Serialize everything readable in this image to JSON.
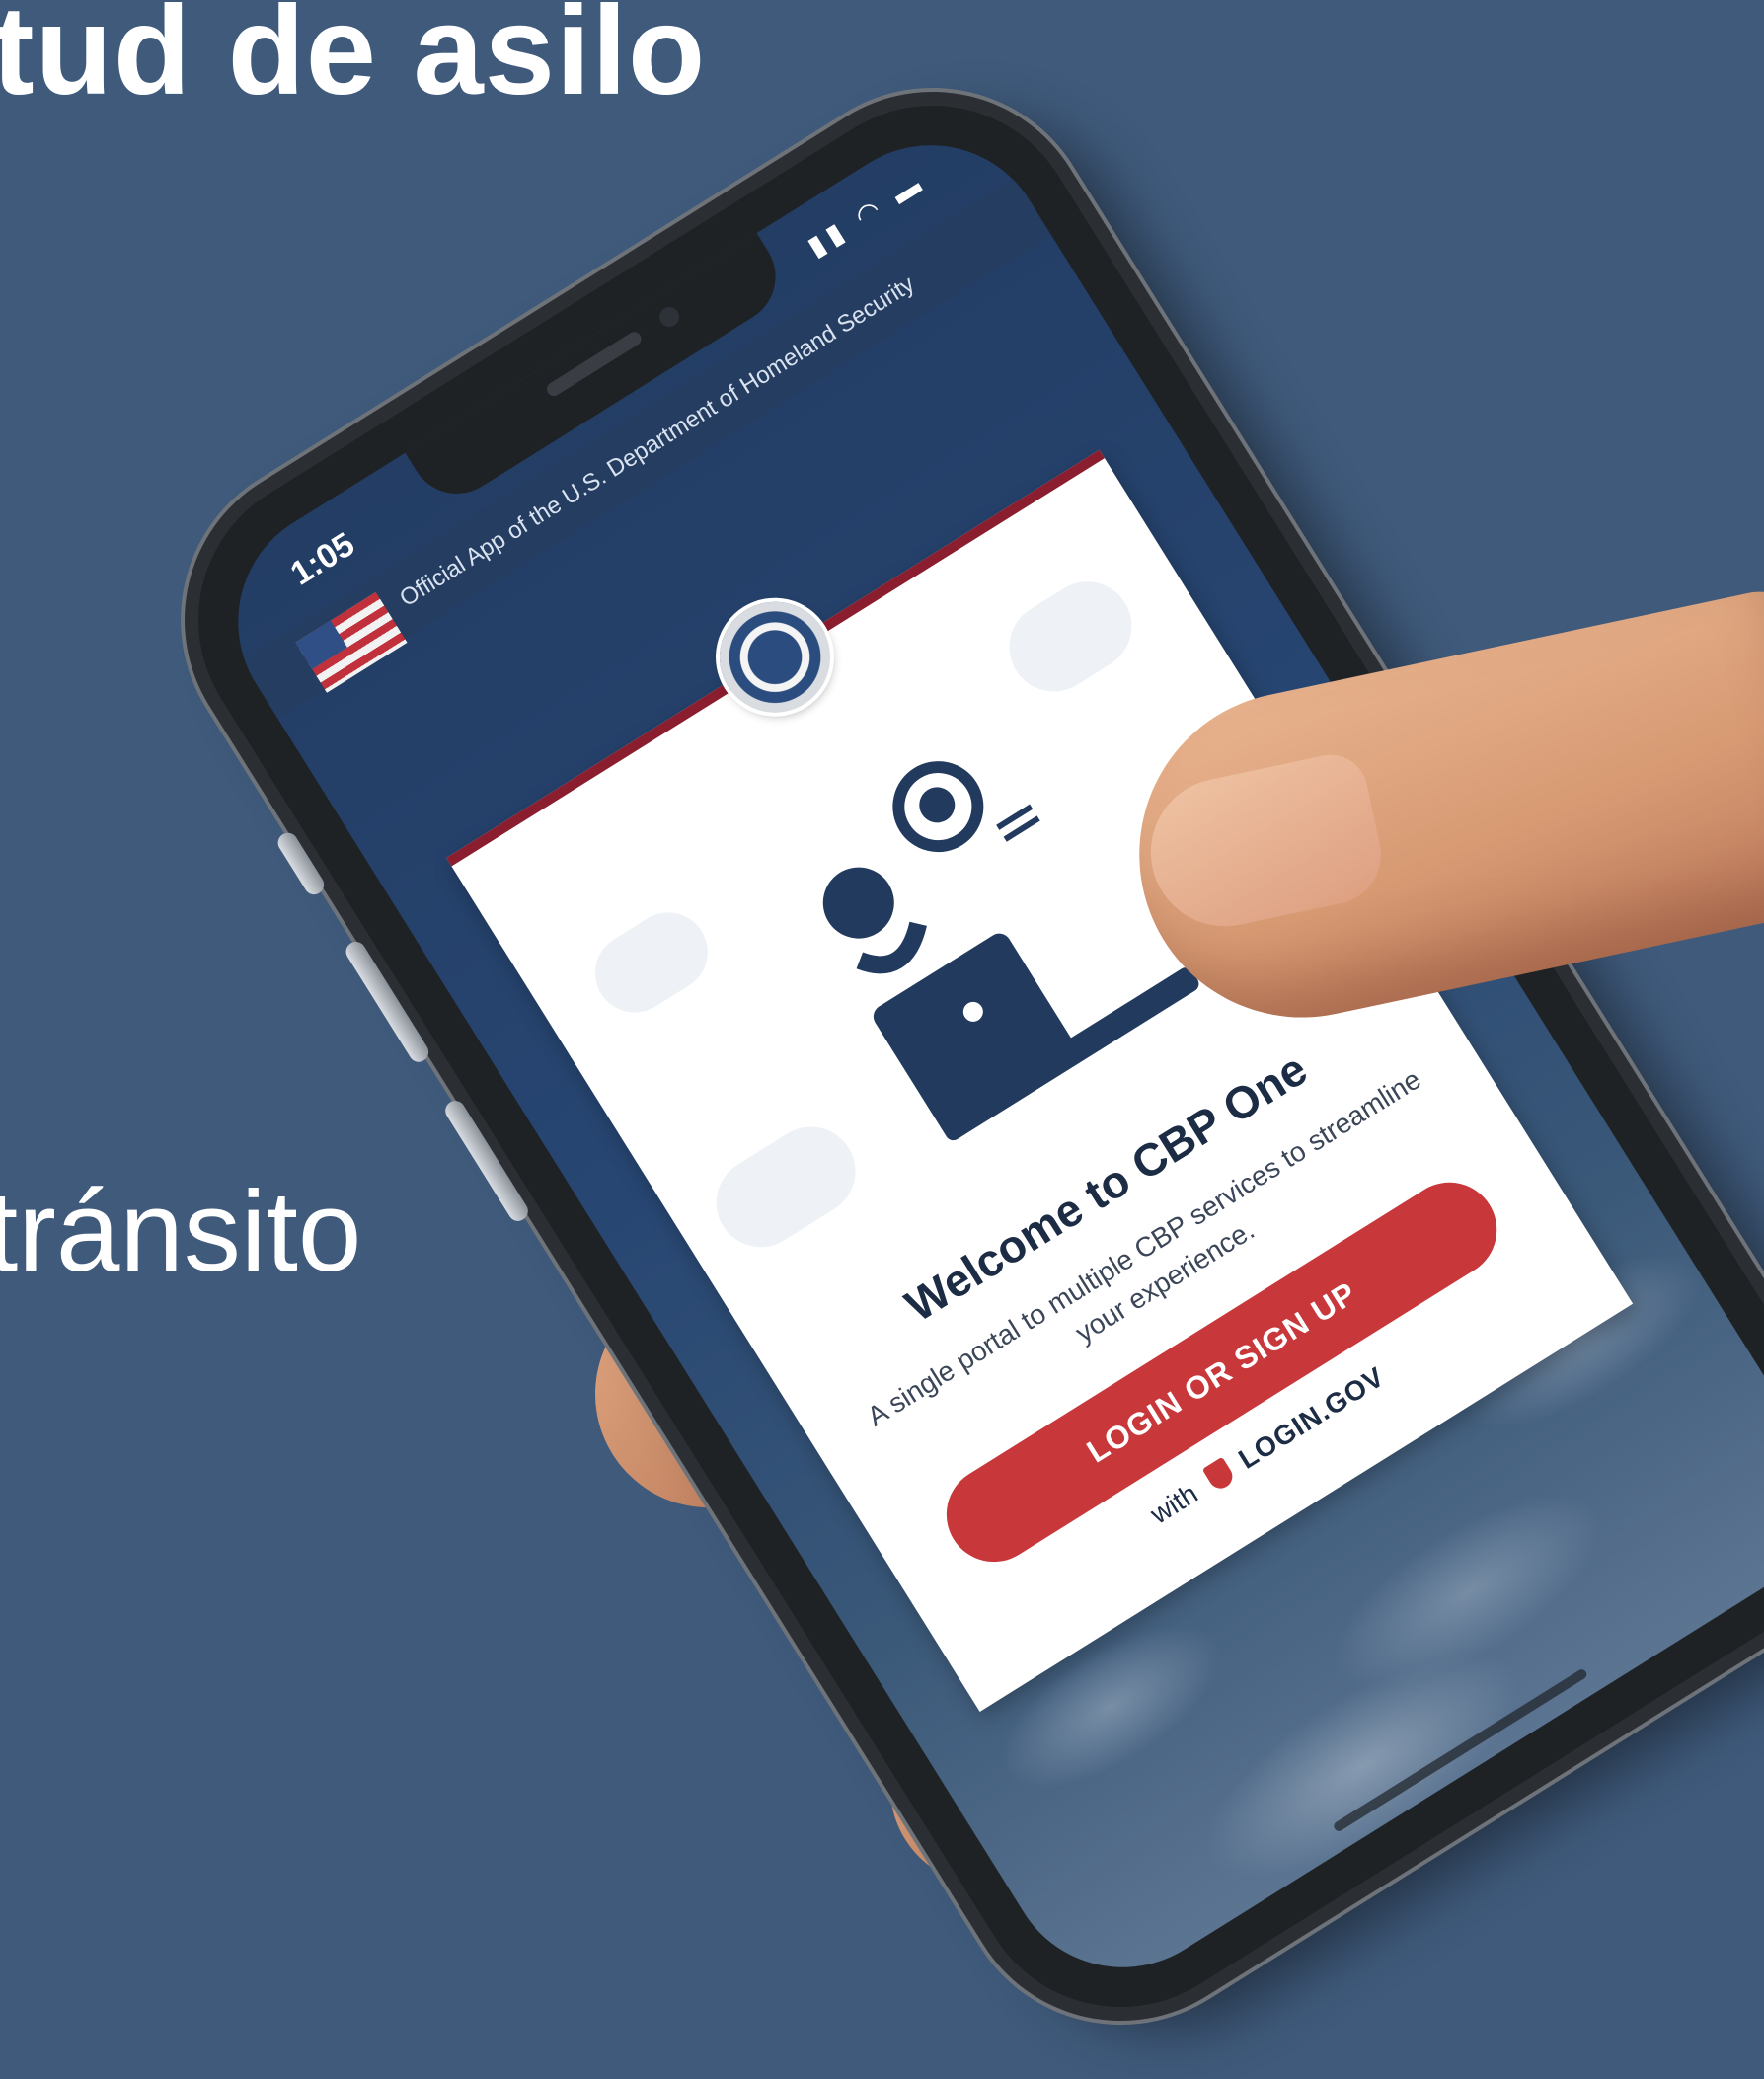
{
  "slide": {
    "title_fragment": "tud de asilo",
    "text_fragment": "tránsito"
  },
  "phone": {
    "status_time": "1:05",
    "status_icons": "▮▮ ◠ ▬",
    "header_text": "Official App of the U.S. Department of Homeland Security",
    "card": {
      "welcome_text": "Welcome to CBP One",
      "subtitle_text": "A single portal to multiple CBP services to streamline your experience.",
      "login_button_label": "LOGIN OR SIGN UP",
      "with_prefix": "with",
      "login_brand": "LOGIN.GOV"
    }
  },
  "colors": {
    "background": "#3f5a7b",
    "login_button": "#c8373a",
    "card_top_border": "#8a1d2e"
  },
  "icons": [
    "flag-icon",
    "dhs-seal-icon",
    "person-laptop-icon",
    "login-gov-shield-icon"
  ]
}
